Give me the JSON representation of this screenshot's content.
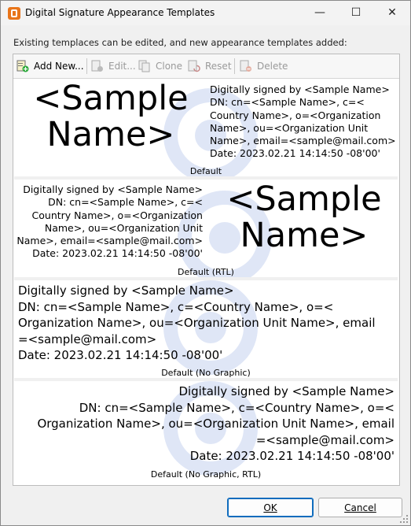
{
  "window": {
    "title": "Digital Signature Appearance Templates",
    "minimize": "—",
    "maximize": "☐",
    "close": "✕"
  },
  "instructions": "Existing templaces can be edited, and new appearance templates added:",
  "toolbar": {
    "add": "Add New...",
    "edit": "Edit...",
    "clone": "Clone",
    "reset": "Reset",
    "delete": "Delete"
  },
  "templates": [
    {
      "name": "Default",
      "big_name_line1": "<Sample",
      "big_name_line2": "Name>",
      "lines": [
        "Digitally signed by <Sample Name>",
        "DN: cn=<Sample Name>, c=<",
        "Country Name>, o=<Organization",
        "Name>, ou=<Organization Unit",
        "Name>, email=<sample@mail.com>",
        "Date: 2023.02.21 14:14:50 -08'00'"
      ]
    },
    {
      "name": "Default (RTL)",
      "big_name_line1": "<Sample",
      "big_name_line2": "Name>",
      "lines": [
        "Digitally signed by <Sample Name>",
        "DN: cn=<Sample Name>, c=<",
        "Country Name>, o=<Organization",
        "Name>, ou=<Organization Unit",
        "Name>, email=<sample@mail.com>",
        "Date: 2023.02.21 14:14:50 -08'00'"
      ]
    },
    {
      "name": "Default (No Graphic)",
      "lines": [
        "Digitally signed by <Sample Name>",
        "DN: cn=<Sample Name>, c=<Country Name>, o=<",
        "Organization Name>, ou=<Organization Unit Name>, email",
        "=<sample@mail.com>",
        "Date: 2023.02.21 14:14:50 -08'00'"
      ]
    },
    {
      "name": "Default (No Graphic, RTL)",
      "lines": [
        "Digitally signed by <Sample Name>",
        "DN: cn=<Sample Name>, c=<Country Name>, o=<",
        "Organization Name>, ou=<Organization Unit Name>, email",
        "=<sample@mail.com>",
        "Date: 2023.02.21 14:14:50 -08'00'"
      ]
    }
  ],
  "buttons": {
    "ok": "OK",
    "cancel": "Cancel"
  }
}
